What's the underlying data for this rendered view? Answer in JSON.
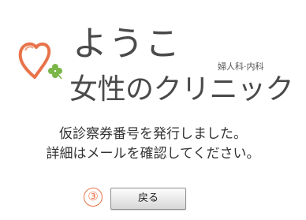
{
  "header": {
    "brand_name": "ようこ",
    "department": "婦人科·内科",
    "clinic_name": "女性のクリニック",
    "logo_icon": "heart-clover-logo",
    "colors": {
      "heart": "#e8734a",
      "clover": "#7ab648",
      "text": "#4a4a4a"
    }
  },
  "message": {
    "line1": "仮診察券番号を発行しました。",
    "line2": "詳細はメールを確認してください。"
  },
  "actions": {
    "step_marker": "③",
    "back_label": "戻る",
    "step_color": "#e8734a"
  }
}
